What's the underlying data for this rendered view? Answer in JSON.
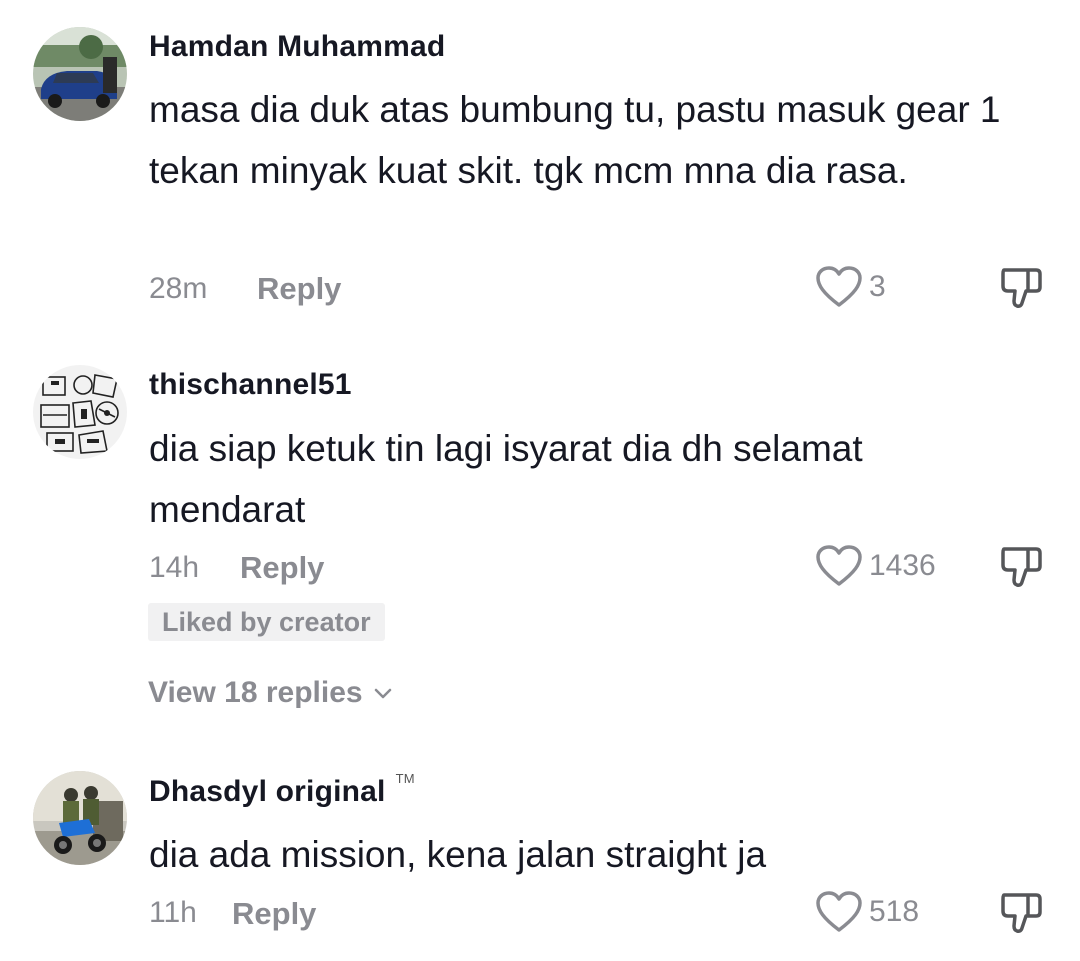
{
  "comments": [
    {
      "username": "Hamdan Muhammad",
      "text": "masa dia duk atas bumbung tu, pastu masuk gear 1 tekan minyak kuat skit. tgk mcm mna dia rasa.",
      "time": "28m",
      "reply_label": "Reply",
      "likes": "3",
      "avatar_icon": "avatar-car-photo"
    },
    {
      "username": "thischannel51",
      "text": "dia siap ketuk tin lagi isyarat dia dh selamat mendarat",
      "time": "14h",
      "reply_label": "Reply",
      "likes": "1436",
      "liked_by_creator": "Liked by creator",
      "view_replies": "View 18 replies",
      "avatar_icon": "avatar-sketch-illustration"
    },
    {
      "username": "Dhasdyl original",
      "badge": "TM",
      "text": "dia ada mission, kena jalan straight ja",
      "time": "11h",
      "reply_label": "Reply",
      "likes": "518",
      "avatar_icon": "avatar-motorcycle-photo"
    }
  ],
  "colors": {
    "text": "#161823",
    "secondary": "#8a8b91",
    "badge_bg": "#f1f1f2"
  }
}
